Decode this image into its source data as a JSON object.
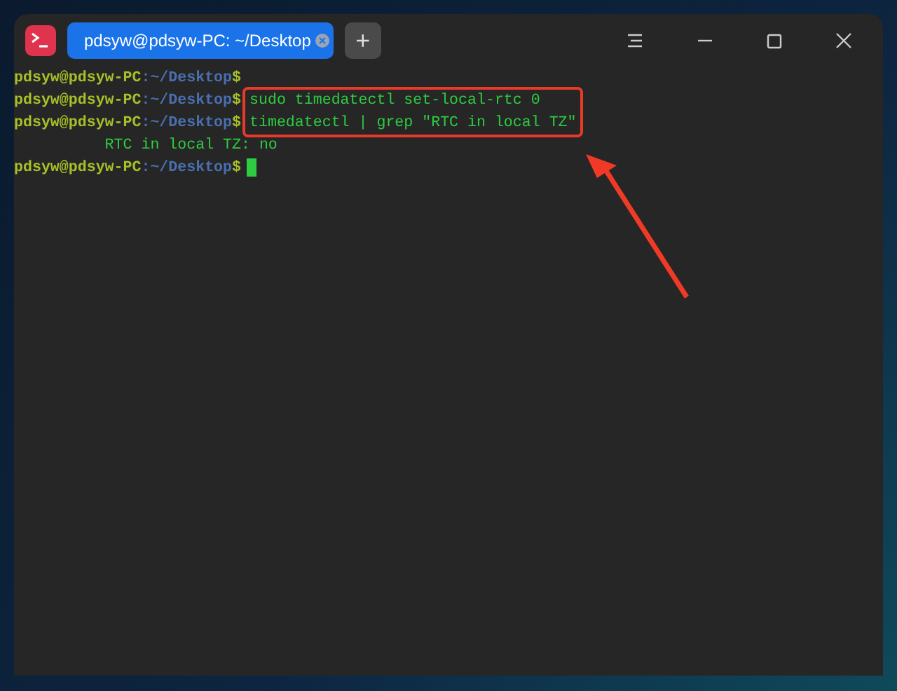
{
  "tabs": [
    {
      "label": "pdsyw@pdsyw-PC: ~/Desktop",
      "selected": true
    }
  ],
  "new_tab": "+",
  "terminal": {
    "lines": [
      {
        "kind": "prompt",
        "user_host": "pdsyw@pdsyw-PC",
        "path": ":~/Desktop",
        "symbol": "$"
      },
      {
        "kind": "prompt",
        "user_host": "pdsyw@pdsyw-PC",
        "path": ":~/Desktop",
        "symbol": "$",
        "command": "sudo timedatectl set-local-rtc 0",
        "highlighted": true
      },
      {
        "kind": "prompt",
        "user_host": "pdsyw@pdsyw-PC",
        "path": ":~/Desktop",
        "symbol": "$",
        "command": "timedatectl | grep \"RTC in local TZ\"",
        "highlighted": true
      },
      {
        "kind": "output",
        "text": "          RTC in local TZ: no"
      },
      {
        "kind": "prompt",
        "user_host": "pdsyw@pdsyw-PC",
        "path": ":~/Desktop",
        "symbol": "$",
        "cursor": true
      }
    ]
  }
}
